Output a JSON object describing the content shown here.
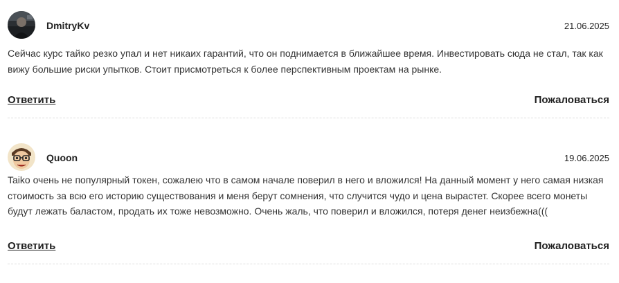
{
  "comments": [
    {
      "author": "DmitryKv",
      "date": "21.06.2025",
      "text": "Сейчас курс тайко резко упал и нет никаих гарантий, что он поднимается в ближайшее время. Инвестировать сюда не стал, так как вижу большие риски упытков. Стоит присмотреться к более перспективным проектам на рынке.",
      "reply_label": "Ответить",
      "report_label": "Пожаловаться",
      "avatar_icon": "avatar-dark-icon"
    },
    {
      "author": "Quoon",
      "date": "19.06.2025",
      "text": "Taiko очень не популярный токен, сожалею что в самом начале поверил в него и вложился! На данный момент у него самая низкая стоимость за всю его историю существования и меня берут сомнения, что случится чудо и цена вырастет. Скорее всего монеты будут лежать баластом, продать их тоже невозможно. Очень жаль, что поверил и вложился, потеря денег неизбежна(((",
      "reply_label": "Ответить",
      "report_label": "Пожаловаться",
      "avatar_icon": "avatar-cartoon-icon"
    }
  ]
}
